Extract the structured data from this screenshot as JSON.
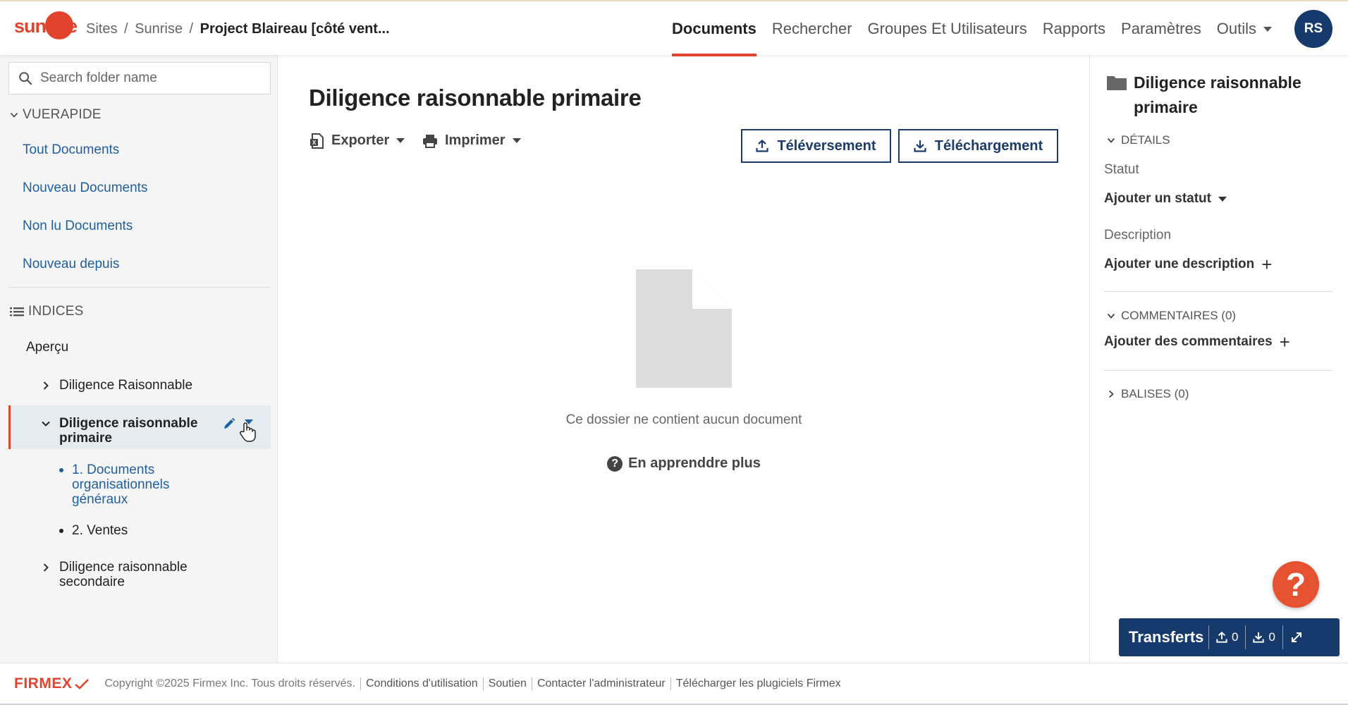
{
  "header": {
    "logo_text": "sunrise",
    "breadcrumb": {
      "sites": "Sites",
      "sep": "/",
      "parent": "Sunrise",
      "current": "Project Blaireau [côté vent..."
    },
    "nav": [
      "Documents",
      "Rechercher",
      "Groupes Et Utilisateurs",
      "Rapports",
      "Paramètres",
      "Outils"
    ],
    "avatar": "RS",
    "colors": {
      "accent": "#e0442c",
      "navy": "#163a6b"
    }
  },
  "sidebar": {
    "search_placeholder": "Search folder name",
    "quick_view_title": "VUERAPIDE",
    "quick_links": [
      "Tout Documents",
      "Nouveau Documents",
      "Non lu Documents",
      "Nouveau depuis"
    ],
    "index_title": "INDICES",
    "tree": {
      "overview": "Aperçu",
      "item1": "Diligence Raisonnable",
      "item2_line1": "Diligence raisonnable",
      "item2_line2": "primaire",
      "sub1_line1": "1. Documents",
      "sub1_line2": "organisationnels",
      "sub1_line3": "généraux",
      "sub2": "2. Ventes",
      "item3_line1": "Diligence raisonnable",
      "item3_line2": "secondaire"
    }
  },
  "main": {
    "title": "Diligence raisonnable primaire",
    "export_label": "Exporter",
    "print_label": "Imprimer",
    "upload_label": "Téléversement",
    "download_label": "Téléchargement",
    "empty_text": "Ce dossier ne contient aucun document",
    "learn_more": "En apprenddre plus"
  },
  "details": {
    "title_line1": "Diligence raisonnable",
    "title_line2": "primaire",
    "details_header": "DÉTAILS",
    "status_label": "Statut",
    "add_status": "Ajouter un statut",
    "description_label": "Description",
    "add_description": "Ajouter une description",
    "comments_header": "COMMENTAIRES (0)",
    "add_comments": "Ajouter des commentaires",
    "tags_header": "BALISES (0)"
  },
  "transfers": {
    "label": "Transferts",
    "uploads": "0",
    "downloads": "0"
  },
  "help": {
    "symbol": "?"
  },
  "footer": {
    "brand": "FIRMEX",
    "links": [
      "Copyright ©2025 Firmex Inc. Tous droits réservés.",
      "Conditions d'utilisation",
      "Soutien",
      "Contacter l'administrateur",
      "Télécharger les plugiciels Firmex"
    ]
  }
}
